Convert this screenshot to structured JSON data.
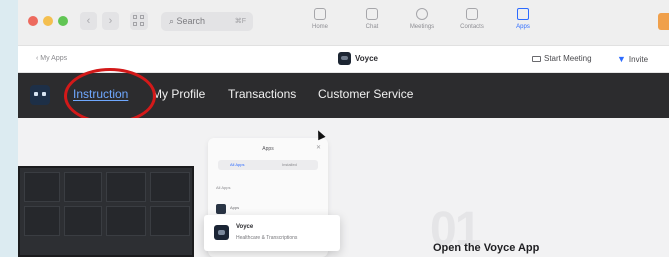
{
  "titlebar": {
    "search_label": "Search",
    "search_shortcut": "⌘F",
    "tabs": [
      {
        "label": "Home",
        "icon": "home-icon"
      },
      {
        "label": "Chat",
        "icon": "chat-icon"
      },
      {
        "label": "Meetings",
        "icon": "clock-icon"
      },
      {
        "label": "Contacts",
        "icon": "contacts-icon"
      },
      {
        "label": "Apps",
        "icon": "apps-icon",
        "active": true
      }
    ]
  },
  "subbar": {
    "back_label": "‹ My Apps",
    "app_name": "Voyce",
    "start_meeting": "Start Meeting",
    "invite": "Invite"
  },
  "navbar": {
    "items": [
      "Instruction",
      "My Profile",
      "Transactions",
      "Customer Service"
    ],
    "active": "Instruction"
  },
  "content": {
    "panel_title": "Apps",
    "panel_tabs": [
      "All Apps",
      "Installed"
    ],
    "panel_label": "All Apps",
    "panel_row": "Apps",
    "card_name": "Voyce",
    "card_desc": "Healthcare & Transcriptions",
    "step_number": "01",
    "step_title": "Open the Voyce App"
  },
  "colors": {
    "accent": "#2d6bff",
    "navbar_bg": "#2c2c2e",
    "highlight_circle": "#d31919"
  }
}
